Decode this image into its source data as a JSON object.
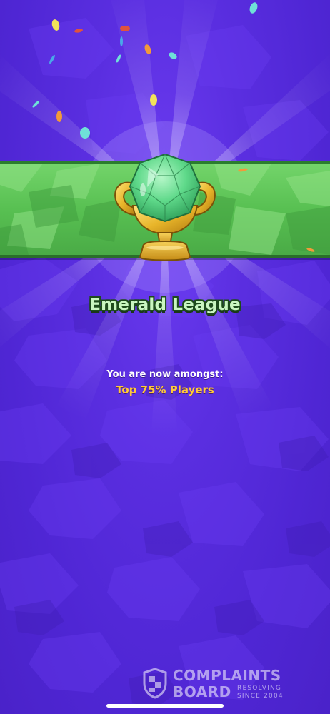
{
  "league": {
    "title": "Emerald League",
    "trophy_icon": "emerald-trophy-icon",
    "banner_color": "#58c052",
    "gem_color": "#5fd98a",
    "cup_color": "#e8b52a"
  },
  "rank": {
    "label": "You are now amongst:",
    "value": "Top 75% Players",
    "value_color": "#ffc83a"
  },
  "background": {
    "primary_color": "#5a2ee0"
  },
  "watermark": {
    "logo_icon": "shield-icon",
    "word1": "COMPLAINTS",
    "word2": "BOARD",
    "tagline1": "RESOLVING",
    "tagline2": "SINCE 2004"
  },
  "system": {
    "home_indicator": "home-indicator"
  }
}
